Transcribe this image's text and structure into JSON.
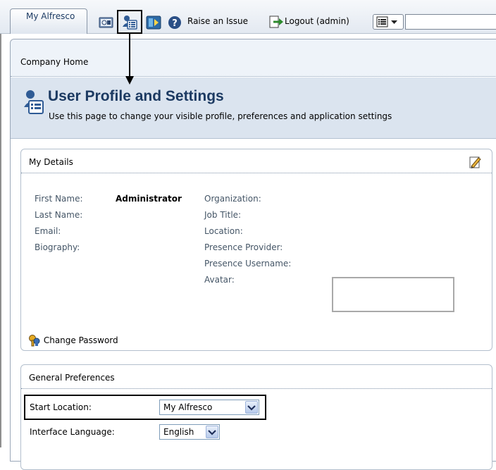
{
  "toolbar": {
    "my_alfresco_tab": "My Alfresco",
    "raise_issue": "Raise an Issue",
    "logout": "Logout (admin)",
    "search": {
      "value": "",
      "placeholder": ""
    },
    "icons": [
      "admin-console-icon",
      "user-profile-icon",
      "help-icon",
      "question-icon",
      "logout-icon",
      "view-options-icon"
    ]
  },
  "breadcrumb": "Company Home",
  "header": {
    "title": "User Profile and Settings",
    "subtitle": "Use this page to change your visible profile, preferences and application settings"
  },
  "my_details": {
    "heading": "My Details",
    "left_fields": [
      {
        "label": "First Name:",
        "value": "Administrator"
      },
      {
        "label": "Last Name:",
        "value": ""
      },
      {
        "label": "Email:",
        "value": ""
      },
      {
        "label": "Biography:",
        "value": ""
      }
    ],
    "right_fields": [
      {
        "label": "Organization:",
        "value": ""
      },
      {
        "label": "Job Title:",
        "value": ""
      },
      {
        "label": "Location:",
        "value": ""
      },
      {
        "label": "Presence Provider:",
        "value": ""
      },
      {
        "label": "Presence Username:",
        "value": ""
      },
      {
        "label": "Avatar:",
        "value": ""
      }
    ],
    "change_password": "Change Password"
  },
  "general_preferences": {
    "heading": "General Preferences",
    "start_location": {
      "label": "Start Location:",
      "value": "My Alfresco"
    },
    "interface_language": {
      "label": "Interface Language:",
      "value": "English"
    }
  },
  "colors": {
    "title": "#1c3a62",
    "title_band": "#dbe4ef",
    "breadcrumb_bar": "#eef3f9"
  }
}
